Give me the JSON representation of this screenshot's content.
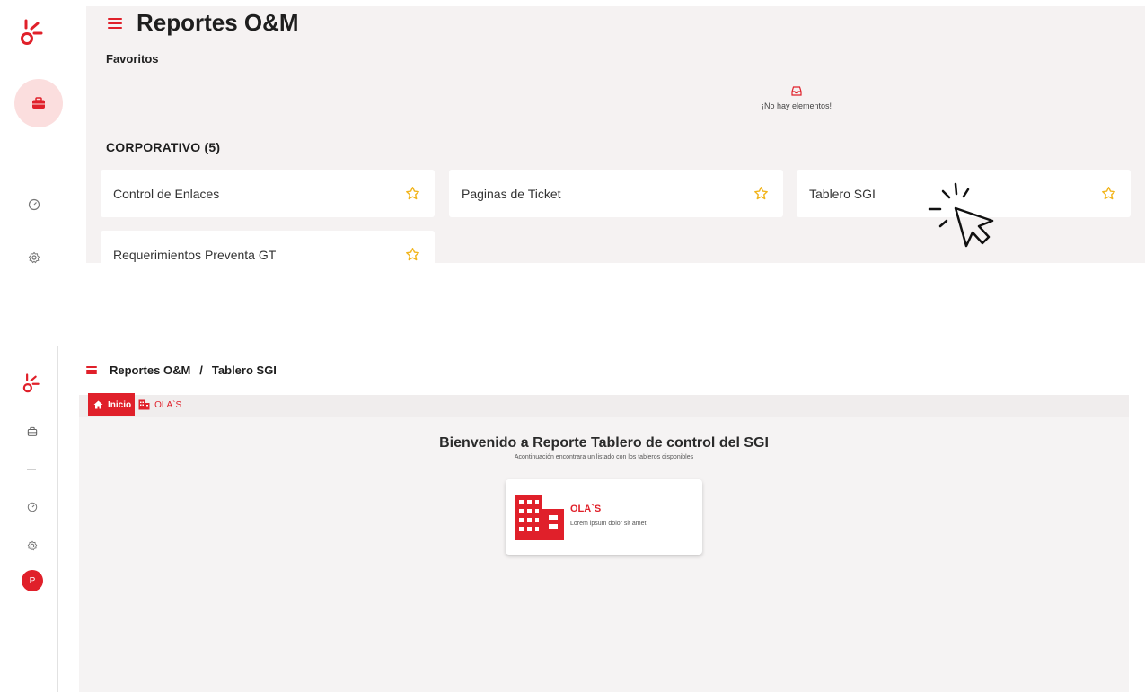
{
  "colors": {
    "accent": "#e0202a",
    "star": "#f2b51d",
    "panel_bg": "#f5f2f2"
  },
  "panel1": {
    "sidebar": {
      "icons": [
        "logo-icon",
        "briefcase-icon",
        "gauge-icon",
        "gear-icon"
      ]
    },
    "header": {
      "title": "Reportes O&M"
    },
    "favorites": {
      "label": "Favoritos",
      "empty_text": "¡No hay elementos!"
    },
    "section": {
      "label": "CORPORATIVO (5)"
    },
    "cards": [
      {
        "label": "Control de Enlaces"
      },
      {
        "label": "Paginas de Ticket"
      },
      {
        "label": "Tablero SGI"
      },
      {
        "label": "Requerimientos Preventa GT"
      }
    ]
  },
  "panel2": {
    "sidebar": {
      "avatar_letter": "P",
      "icons": [
        "logo-icon",
        "briefcase-icon",
        "gauge-icon",
        "gear-icon"
      ]
    },
    "breadcrumb": {
      "root": "Reportes O&M",
      "separator": "/",
      "current": "Tablero SGI"
    },
    "tabs": [
      {
        "label": "Inicio",
        "icon": "home-icon"
      },
      {
        "label": "OLA`S",
        "icon": "building-icon"
      }
    ],
    "welcome": {
      "title": "Bienvenido a Reporte Tablero de control del SGI",
      "subtitle": "Acontinuación encontrara un listado con los tableros disponibles"
    },
    "dashboard_card": {
      "title": "OLA`S",
      "description": "Lorem ipsum dolor sit amet.",
      "icon": "building-icon"
    }
  }
}
